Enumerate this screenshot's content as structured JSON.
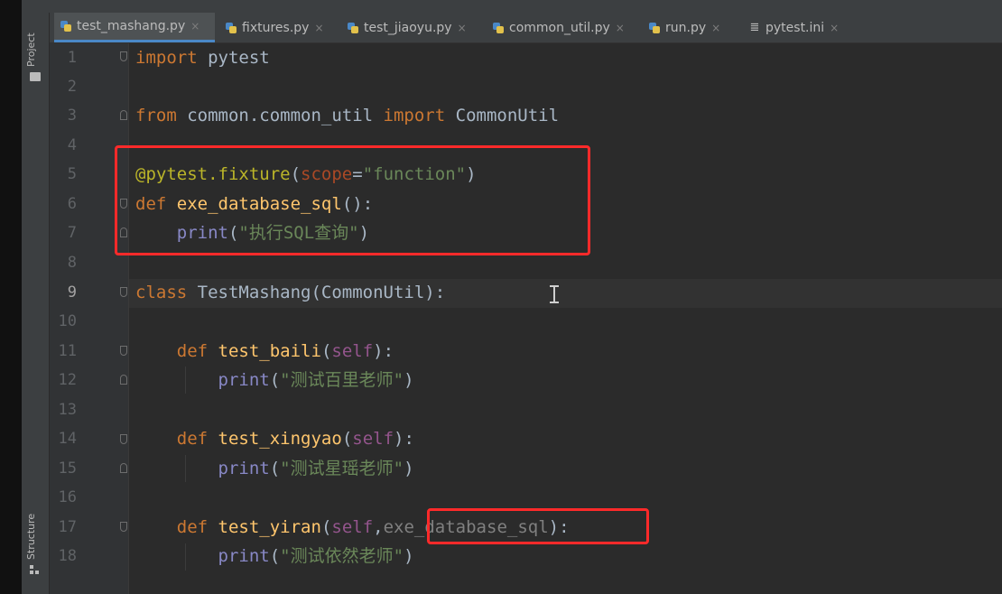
{
  "sidebar": {
    "project_label": "Project",
    "structure_label": "Structure"
  },
  "tabs": [
    {
      "label": "test_mashang.py",
      "icon": "python-file-icon",
      "active": true
    },
    {
      "label": "fixtures.py",
      "icon": "python-file-icon"
    },
    {
      "label": "test_jiaoyu.py",
      "icon": "python-file-icon"
    },
    {
      "label": "common_util.py",
      "icon": "python-file-icon"
    },
    {
      "label": "run.py",
      "icon": "python-file-icon"
    },
    {
      "label": "pytest.ini",
      "icon": "ini-file-icon"
    }
  ],
  "close_glyph": "×",
  "line_numbers": [
    "1",
    "2",
    "3",
    "4",
    "5",
    "6",
    "7",
    "8",
    "9",
    "10",
    "11",
    "12",
    "13",
    "14",
    "15",
    "16",
    "17",
    "18"
  ],
  "current_line": "9",
  "code": {
    "l1": {
      "kw": "import",
      "rest": " pytest"
    },
    "l3": {
      "kw1": "from",
      "mod": " common.common_util ",
      "kw2": "import",
      "cls": " CommonUtil"
    },
    "l5": {
      "deco": "@pytest.fixture",
      "p1": "(",
      "param": "scope",
      "eq": "=",
      "str": "\"function\"",
      "p2": ")"
    },
    "l6": {
      "kw": "def",
      "sp": " ",
      "fn": "exe_database_sql",
      "rest": "():"
    },
    "l7": {
      "indent": "    ",
      "call": "print",
      "p1": "(",
      "str": "\"执行SQL查询\"",
      "p2": ")"
    },
    "l9": {
      "kw": "class",
      "rest": " TestMashang(CommonUtil):"
    },
    "l11": {
      "indent": "    ",
      "kw": "def",
      "sp": " ",
      "fn": "test_baili",
      "p1": "(",
      "self": "self",
      "p2": "):"
    },
    "l12": {
      "indent": "        ",
      "call": "print",
      "p1": "(",
      "str": "\"测试百里老师\"",
      "p2": ")"
    },
    "l14": {
      "indent": "    ",
      "kw": "def",
      "sp": " ",
      "fn": "test_xingyao",
      "p1": "(",
      "self": "self",
      "p2": "):"
    },
    "l15": {
      "indent": "        ",
      "call": "print",
      "p1": "(",
      "str": "\"测试星瑶老师\"",
      "p2": ")"
    },
    "l17": {
      "indent": "    ",
      "kw": "def",
      "sp": " ",
      "fn": "test_yiran",
      "p1": "(",
      "self": "self",
      "comma": ",",
      "arg": "exe_database_sql",
      "p2": "):"
    },
    "l18": {
      "indent": "        ",
      "call": "print",
      "p1": "(",
      "str": "\"测试依然老师\"",
      "p2": ")"
    }
  },
  "colors": {
    "keyword": "#cc7832",
    "function": "#ffc66d",
    "string": "#6a8759",
    "decorator": "#bbb529",
    "self": "#94558d",
    "highlight_box": "#ff2a2a",
    "active_tab_underline": "#4a88c7"
  }
}
